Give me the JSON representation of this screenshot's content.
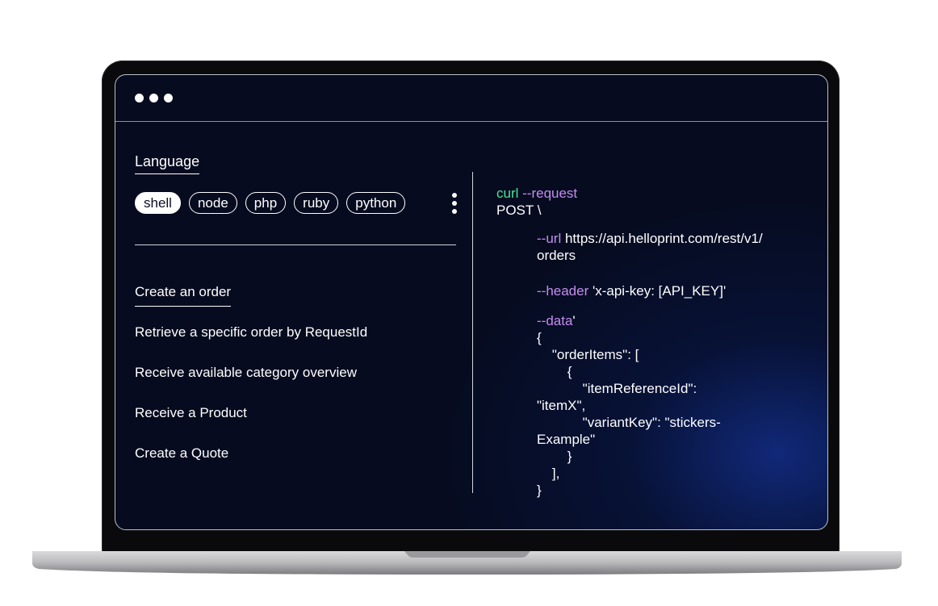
{
  "window": {
    "controls": [
      "dot",
      "dot",
      "dot"
    ]
  },
  "language": {
    "heading": "Language",
    "options": [
      "shell",
      "node",
      "php",
      "ruby",
      "python"
    ],
    "selected": "shell"
  },
  "endpoints": [
    "Create an order",
    "Retrieve a specific order by RequestId",
    "Receive available category overview",
    "Receive a Product",
    "Create a Quote"
  ],
  "code": {
    "l1_cmd": "curl",
    "l1_flag": " --request",
    "l2": "POST \\",
    "l3_flag": "--url",
    "l3_val": " https://api.helloprint.com/rest/v1/",
    "l4": "orders",
    "l5_flag": "--header",
    "l5_val": " 'x-api-key: [API_KEY]'",
    "l6_flag": "--data",
    "l6_val": "'",
    "l7": "{",
    "l8": "    \"orderItems\": [",
    "l9": "        {",
    "l10": "            \"itemReferenceId\":",
    "l11": "\"itemX\",",
    "l12": "            \"variantKey\": \"stickers-",
    "l13": "Example\"",
    "l14": "        }",
    "l15": "    ],",
    "l16": "}"
  },
  "colors": {
    "background": "#060b1f",
    "accent_green": "#4be39b",
    "accent_purple": "#c58cf0"
  },
  "icons": [
    "more-vertical-icon"
  ]
}
